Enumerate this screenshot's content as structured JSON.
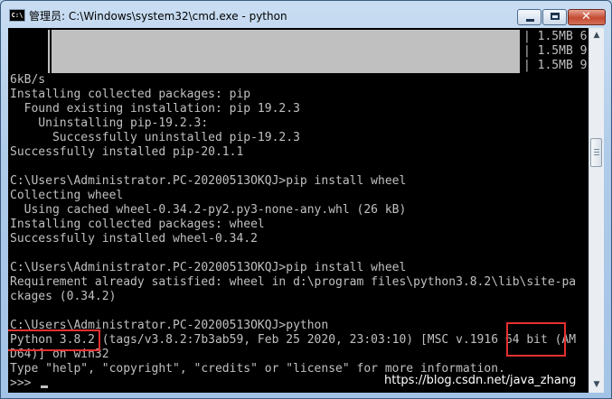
{
  "window": {
    "title": "管理员: C:\\Windows\\system32\\cmd.exe - python",
    "icon_label": "C:\\",
    "minimize": "minimize-icon",
    "maximize": "maximize-icon",
    "close": "close-icon",
    "close_glyph": "✕"
  },
  "console": {
    "lines": [
      " ▌",
      "   ▌",
      "   ▌",
      "6kB/s",
      "Installing collected packages: pip",
      "  Found existing installation: pip 19.2.3",
      "    Uninstalling pip-19.2.3:",
      "      Successfully uninstalled pip-19.2.3",
      "Successfully installed pip-20.1.1",
      "",
      "C:\\Users\\Administrator.PC-20200513OKQJ>pip install wheel",
      "Collecting wheel",
      "  Using cached wheel-0.34.2-py2.py3-none-any.whl (26 kB)",
      "Installing collected packages: wheel",
      "Successfully installed wheel-0.34.2",
      "",
      "C:\\Users\\Administrator.PC-20200513OKQJ>pip install wheel",
      "Requirement already satisfied: wheel in d:\\program files\\python3.8.2\\lib\\site-pa",
      "ckages (0.34.2)",
      "",
      "C:\\Users\\Administrator.PC-20200513OKQJ>python",
      "Python 3.8.2 (tags/v3.8.2:7b3ab59, Feb 25 2020, 23:03:10) [MSC v.1916 64 bit (AM",
      "D64)] on win32",
      "Type \"help\", \"copyright\", \"credits\" or \"license\" for more information.",
      ">>> "
    ],
    "progress_right": [
      "| 1.5MB 6.",
      "| 1.5MB 9.",
      "| 1.5MB 9."
    ]
  },
  "annotations": {
    "highlight_color": "#e53030"
  },
  "watermark": "https://blog.csdn.net/java_zhang"
}
